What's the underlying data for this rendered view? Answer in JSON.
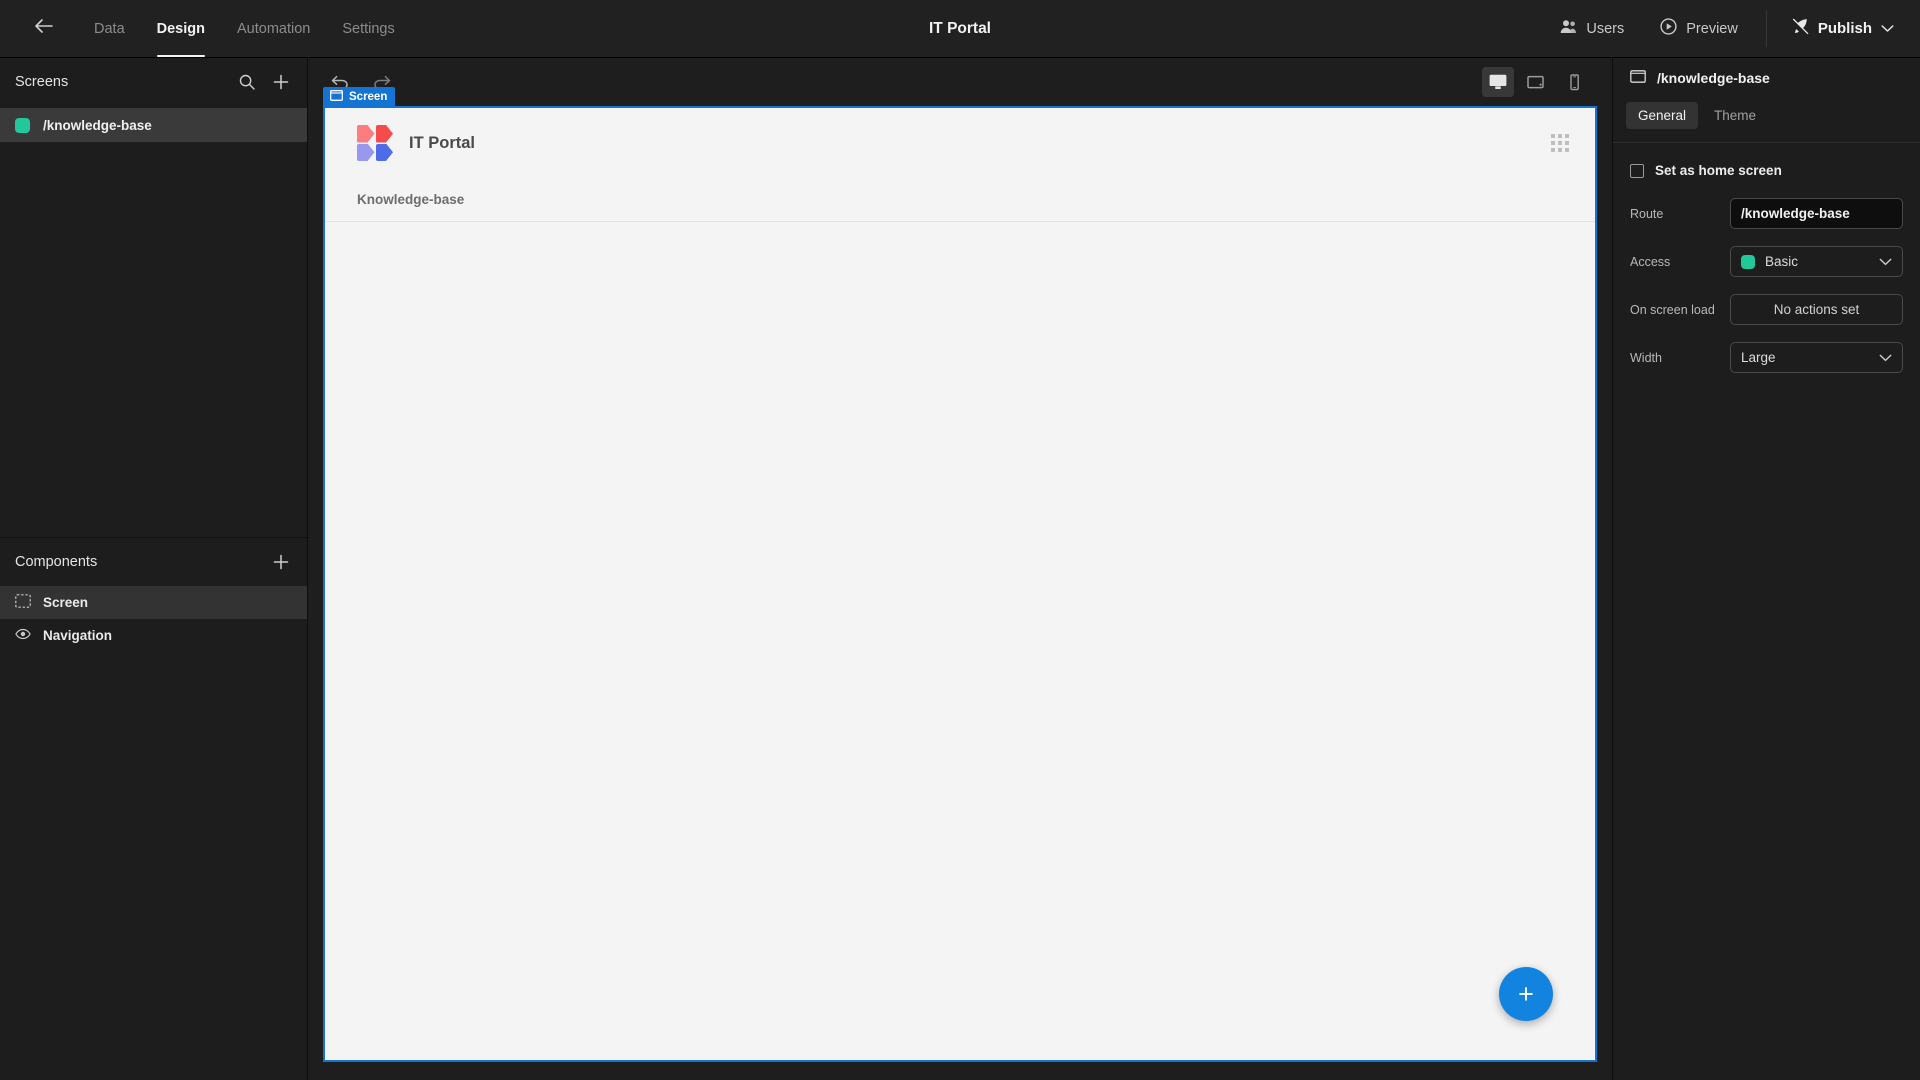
{
  "topbar": {
    "back_icon": "arrow-left-icon",
    "tabs": [
      {
        "label": "Data",
        "active": false
      },
      {
        "label": "Design",
        "active": true
      },
      {
        "label": "Automation",
        "active": false
      },
      {
        "label": "Settings",
        "active": false
      }
    ],
    "app_title": "IT Portal",
    "users_label": "Users",
    "preview_label": "Preview",
    "publish_label": "Publish"
  },
  "sidebar": {
    "screens": {
      "title": "Screens",
      "items": [
        {
          "label": "/knowledge-base",
          "access_color": "#22c79a",
          "selected": true
        }
      ]
    },
    "components": {
      "title": "Components",
      "items": [
        {
          "label": "Screen",
          "icon": "screen-icon",
          "selected": true
        },
        {
          "label": "Navigation",
          "icon": "eye-icon",
          "selected": false
        }
      ]
    }
  },
  "canvas": {
    "screen_tag": "Screen",
    "app_name": "IT Portal",
    "nav_links": [
      "Knowledge-base"
    ],
    "fab_label": "+",
    "logo_colors": [
      "#fc7d7d",
      "#f64b4b",
      "#9898f0",
      "#4f6ce8"
    ],
    "selection_color": "#1374d4",
    "devices": [
      {
        "name": "desktop",
        "active": true
      },
      {
        "name": "tablet",
        "active": false
      },
      {
        "name": "mobile",
        "active": false
      }
    ]
  },
  "inspector": {
    "title": "/knowledge-base",
    "tabs": [
      {
        "label": "General",
        "active": true
      },
      {
        "label": "Theme",
        "active": false
      }
    ],
    "home_screen_label": "Set as home screen",
    "home_screen_checked": false,
    "fields": {
      "route_label": "Route",
      "route_value": "/knowledge-base",
      "access_label": "Access",
      "access_value": "Basic",
      "access_color": "#22c79a",
      "onload_label": "On screen load",
      "onload_value": "No actions set",
      "width_label": "Width",
      "width_value": "Large"
    }
  }
}
